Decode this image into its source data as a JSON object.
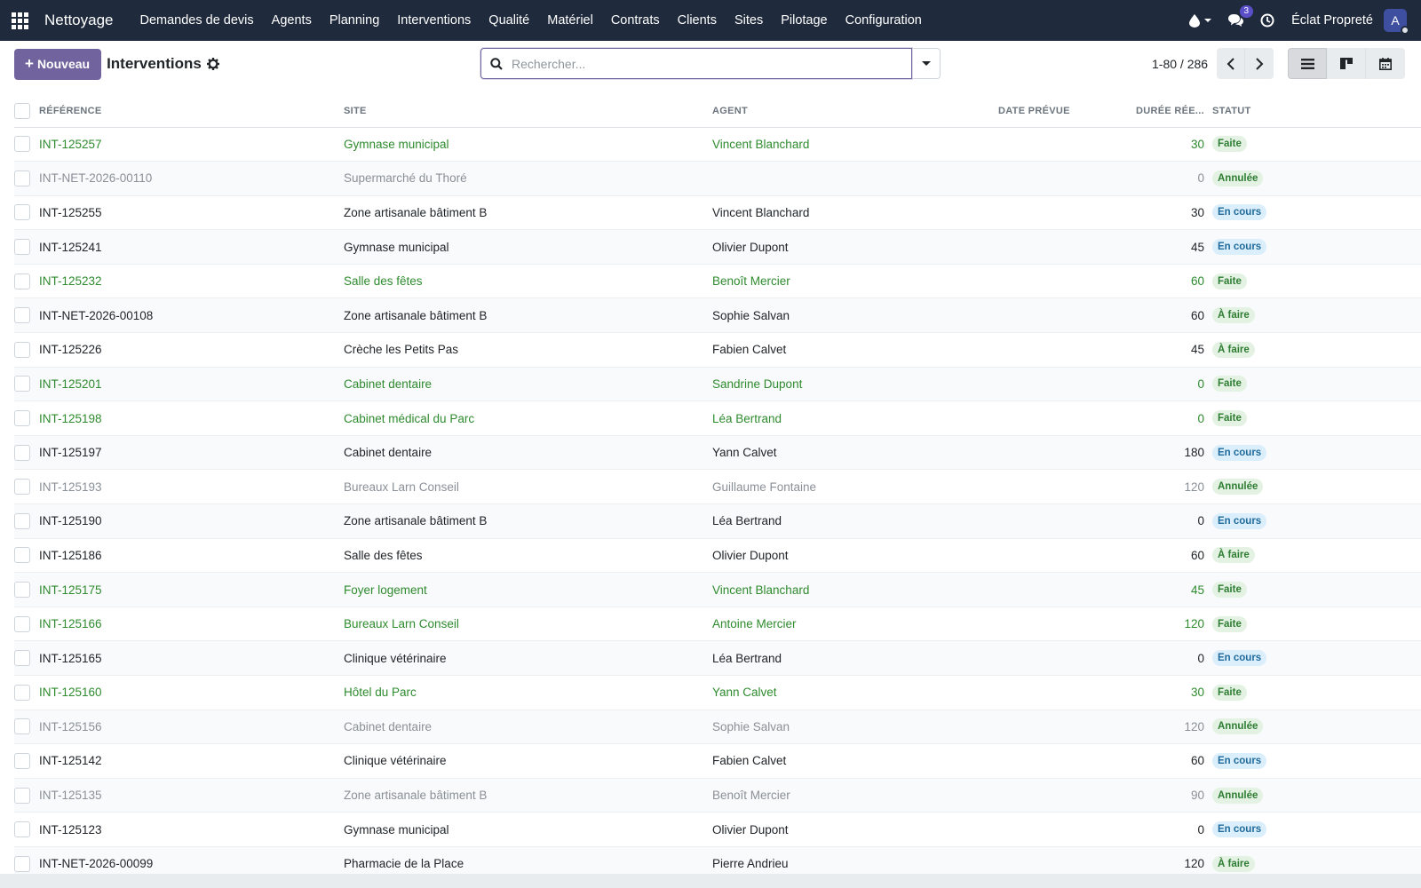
{
  "navbar": {
    "brand": "Nettoyage",
    "menu": [
      "Demandes de devis",
      "Agents",
      "Planning",
      "Interventions",
      "Qualité",
      "Matériel",
      "Contrats",
      "Clients",
      "Sites",
      "Pilotage",
      "Configuration"
    ],
    "messages_count": "3",
    "company": "Éclat Propreté",
    "avatar_letter": "A"
  },
  "control": {
    "new_label": "Nouveau",
    "title": "Interventions",
    "search_placeholder": "Rechercher...",
    "pager": "1-80 / 286"
  },
  "table": {
    "headers": {
      "reference": "RÉFÉRENCE",
      "site": "SITE",
      "agent": "AGENT",
      "date": "DATE PRÉVUE",
      "duration": "DURÉE RÉE...",
      "status": "STATUT"
    },
    "rows": [
      {
        "ref": "INT-125257",
        "site": "Gymnase municipal",
        "agent": "Vincent Blanchard",
        "date": "",
        "duration": "30",
        "status": "Faite"
      },
      {
        "ref": "INT-NET-2026-00110",
        "site": "Supermarché du Thoré",
        "agent": "",
        "date": "",
        "duration": "0",
        "status": "Annulée"
      },
      {
        "ref": "INT-125255",
        "site": "Zone artisanale bâtiment B",
        "agent": "Vincent Blanchard",
        "date": "",
        "duration": "30",
        "status": "En cours"
      },
      {
        "ref": "INT-125241",
        "site": "Gymnase municipal",
        "agent": "Olivier Dupont",
        "date": "",
        "duration": "45",
        "status": "En cours"
      },
      {
        "ref": "INT-125232",
        "site": "Salle des fêtes",
        "agent": "Benoît Mercier",
        "date": "",
        "duration": "60",
        "status": "Faite"
      },
      {
        "ref": "INT-NET-2026-00108",
        "site": "Zone artisanale bâtiment B",
        "agent": "Sophie Salvan",
        "date": "",
        "duration": "60",
        "status": "À faire"
      },
      {
        "ref": "INT-125226",
        "site": "Crèche les Petits Pas",
        "agent": "Fabien Calvet",
        "date": "",
        "duration": "45",
        "status": "À faire"
      },
      {
        "ref": "INT-125201",
        "site": "Cabinet dentaire",
        "agent": "Sandrine Dupont",
        "date": "",
        "duration": "0",
        "status": "Faite"
      },
      {
        "ref": "INT-125198",
        "site": "Cabinet médical du Parc",
        "agent": "Léa Bertrand",
        "date": "",
        "duration": "0",
        "status": "Faite"
      },
      {
        "ref": "INT-125197",
        "site": "Cabinet dentaire",
        "agent": "Yann Calvet",
        "date": "",
        "duration": "180",
        "status": "En cours"
      },
      {
        "ref": "INT-125193",
        "site": "Bureaux Larn Conseil",
        "agent": "Guillaume Fontaine",
        "date": "",
        "duration": "120",
        "status": "Annulée"
      },
      {
        "ref": "INT-125190",
        "site": "Zone artisanale bâtiment B",
        "agent": "Léa Bertrand",
        "date": "",
        "duration": "0",
        "status": "En cours"
      },
      {
        "ref": "INT-125186",
        "site": "Salle des fêtes",
        "agent": "Olivier Dupont",
        "date": "",
        "duration": "60",
        "status": "À faire"
      },
      {
        "ref": "INT-125175",
        "site": "Foyer logement",
        "agent": "Vincent Blanchard",
        "date": "",
        "duration": "45",
        "status": "Faite"
      },
      {
        "ref": "INT-125166",
        "site": "Bureaux Larn Conseil",
        "agent": "Antoine Mercier",
        "date": "",
        "duration": "120",
        "status": "Faite"
      },
      {
        "ref": "INT-125165",
        "site": "Clinique vétérinaire",
        "agent": "Léa Bertrand",
        "date": "",
        "duration": "0",
        "status": "En cours"
      },
      {
        "ref": "INT-125160",
        "site": "Hôtel du Parc",
        "agent": "Yann Calvet",
        "date": "",
        "duration": "30",
        "status": "Faite"
      },
      {
        "ref": "INT-125156",
        "site": "Cabinet dentaire",
        "agent": "Sophie Salvan",
        "date": "",
        "duration": "120",
        "status": "Annulée"
      },
      {
        "ref": "INT-125142",
        "site": "Clinique vétérinaire",
        "agent": "Fabien Calvet",
        "date": "",
        "duration": "60",
        "status": "En cours"
      },
      {
        "ref": "INT-125135",
        "site": "Zone artisanale bâtiment B",
        "agent": "Benoît Mercier",
        "date": "",
        "duration": "90",
        "status": "Annulée"
      },
      {
        "ref": "INT-125123",
        "site": "Gymnase municipal",
        "agent": "Olivier Dupont",
        "date": "",
        "duration": "0",
        "status": "En cours"
      },
      {
        "ref": "INT-NET-2026-00099",
        "site": "Pharmacie de la Place",
        "agent": "Pierre Andrieu",
        "date": "",
        "duration": "120",
        "status": "À faire"
      }
    ]
  },
  "colors": {
    "navbar_bg": "#1f2a3c",
    "primary": "#71639e",
    "done_text": "#2e8b2e",
    "cancel_text": "#8a9097"
  }
}
